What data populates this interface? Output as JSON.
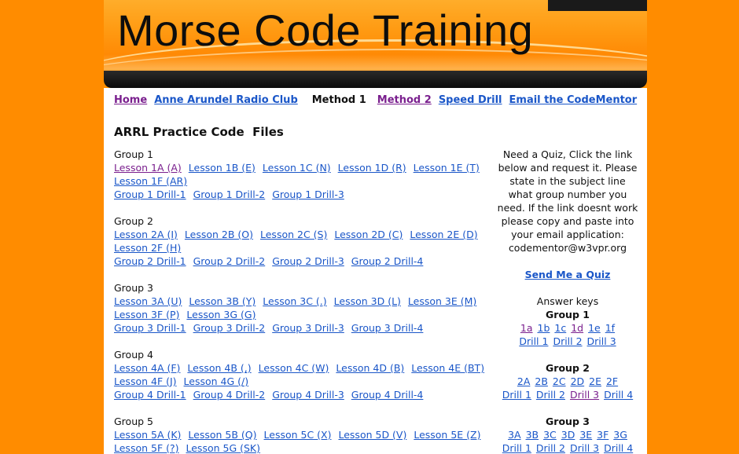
{
  "site_title": "Morse Code Training",
  "nav": {
    "home": "Home",
    "club": "Anne Arundel Radio Club",
    "method1": "Method 1",
    "method2": "Method 2",
    "speed_drill": "Speed Drill",
    "email": "Email the CodeMentor"
  },
  "heading": "ARRL Practice Code  Files",
  "groups": [
    {
      "title": "Group 1",
      "lessons": [
        "Lesson 1A (A)",
        "Lesson 1B (E)",
        "Lesson 1C (N)",
        "Lesson 1D (R)",
        "Lesson 1E (T)",
        "Lesson 1F (AR)"
      ],
      "drills": [
        "Group 1 Drill-1",
        "Group 1 Drill-2",
        "Group 1 Drill-3"
      ]
    },
    {
      "title": "Group 2",
      "lessons": [
        "Lesson 2A (I)",
        "Lesson 2B (O)",
        "Lesson 2C (S)",
        "Lesson 2D (C)",
        "Lesson 2E (D)",
        "Lesson 2F (H)"
      ],
      "drills": [
        "Group 2 Drill-1",
        "Group 2 Drill-2",
        "Group 2 Drill-3",
        "Group 2 Drill-4"
      ]
    },
    {
      "title": "Group 3",
      "lessons": [
        "Lesson 3A (U)",
        "Lesson 3B (Y)",
        "Lesson 3C (.)",
        "Lesson 3D (L)",
        "Lesson 3E (M)",
        "Lesson 3F (P)",
        "Lesson 3G (G)"
      ],
      "drills": [
        "Group 3 Drill-1",
        "Group 3 Drill-2",
        "Group 3 Drill-3",
        "Group 3 Drill-4"
      ]
    },
    {
      "title": "Group 4",
      "lessons": [
        "Lesson 4A (F)",
        "Lesson 4B (,)",
        "Lesson 4C (W)",
        "Lesson 4D (B)",
        "Lesson 4E (BT)",
        "Lesson 4F (J)",
        "Lesson 4G (/)"
      ],
      "drills": [
        "Group 4 Drill-1",
        "Group 4 Drill-2",
        "Group 4 Drill-3",
        "Group 4 Drill-4"
      ]
    },
    {
      "title": "Group 5",
      "lessons": [
        "Lesson 5A (K)",
        "Lesson 5B (Q)",
        "Lesson 5C (X)",
        "Lesson 5D (V)",
        "Lesson 5E (Z)",
        "Lesson 5F (?)",
        "Lesson 5G (SK)"
      ]
    }
  ],
  "sidebar": {
    "quiz_text": [
      "Need a Quiz, Click the link",
      "below and request it. Please",
      "state in the subject line",
      "what group number you",
      "need. If the link doesnt work",
      "please copy and paste into",
      "your email application:",
      "codementor@w3vpr.org"
    ],
    "quiz_link": "Send Me a Quiz",
    "answer_keys_label": "Answer keys",
    "key_groups": [
      {
        "title": "Group 1",
        "keys": [
          "1a",
          "1b",
          "1c",
          "1d",
          "1e",
          "1f"
        ],
        "drills": [
          "Drill 1",
          "Drill 2",
          "Drill 3"
        ]
      },
      {
        "title": "Group 2",
        "keys": [
          "2A",
          "2B",
          "2C",
          "2D",
          "2E",
          "2F"
        ],
        "drills": [
          "Drill 1",
          "Drill 2",
          "Drill 3",
          "Drill 4"
        ]
      },
      {
        "title": "Group 3",
        "keys": [
          "3A",
          "3B",
          "3C",
          "3D",
          "3E",
          "3F",
          "3G"
        ],
        "drills": [
          "Drill 1",
          "Drill 2",
          "Drill 3",
          "Drill 4"
        ]
      }
    ]
  },
  "colors": {
    "background": "#ff8c00",
    "link": "#1a56c8",
    "visited_link": "#7a1f8e"
  }
}
